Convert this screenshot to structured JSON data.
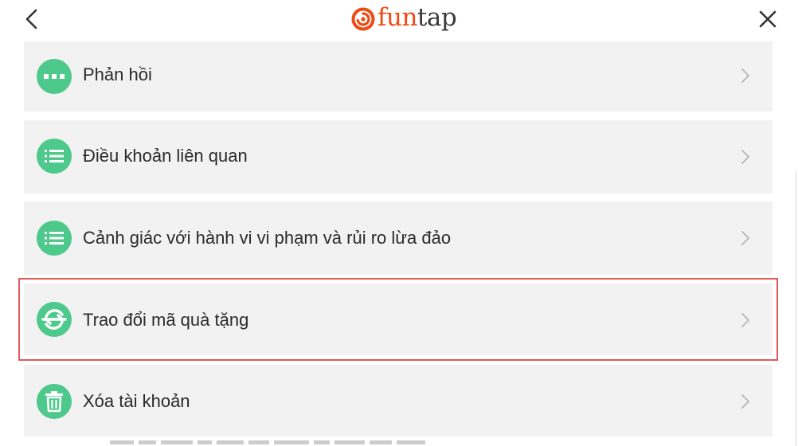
{
  "header": {
    "logo_fun": "fun",
    "logo_tap": "tap",
    "brand_color": "#ee4a14"
  },
  "menu": {
    "items": [
      {
        "label": "Phản hồi",
        "icon": "ellipsis-icon"
      },
      {
        "label": "Điều khoản liên quan",
        "icon": "list-icon"
      },
      {
        "label": "Cảnh giác với hành vi vi phạm và rủi ro lừa đảo",
        "icon": "list-icon"
      },
      {
        "label": "Trao đổi mã quà tặng",
        "icon": "exchange-icon"
      },
      {
        "label": "Xóa tài khoản",
        "icon": "trash-icon"
      }
    ]
  },
  "colors": {
    "icon_bg": "#4ec98c",
    "row_bg": "#f2f2f2",
    "highlight": "#e05a5a"
  }
}
